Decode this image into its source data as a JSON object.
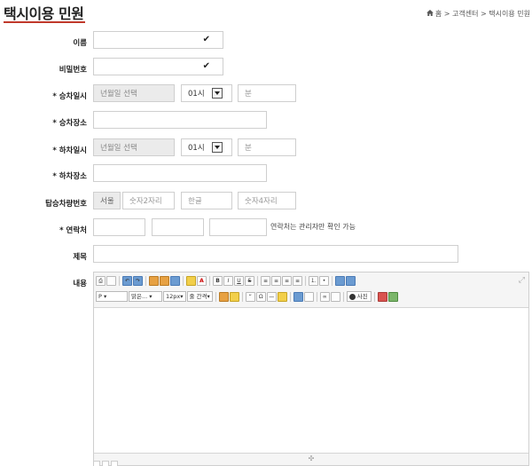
{
  "page": {
    "title": "택시이용 민원",
    "breadcrumb": "홈 > 고객센터 > 택시이용 민원"
  },
  "form": {
    "name": {
      "label": "이름",
      "value": ""
    },
    "password": {
      "label": "비밀번호",
      "value": ""
    },
    "pickup_datetime": {
      "label": "* 승차일시",
      "date_placeholder": "년월일 선택",
      "hour": "01시",
      "minute_placeholder": "분"
    },
    "pickup_place": {
      "label": "* 승차장소",
      "value": ""
    },
    "dropoff_datetime": {
      "label": "* 하차일시",
      "date_placeholder": "년월일 선택",
      "hour": "01시",
      "minute_placeholder": "분"
    },
    "dropoff_place": {
      "label": "* 하차장소",
      "value": ""
    },
    "vehicle_number": {
      "label": "탑승차량번호",
      "region": "서울",
      "p1": "숫자2자리",
      "p2": "한글",
      "p3": "숫자4자리"
    },
    "contact": {
      "label": "* 연락처",
      "note": "연락처는 관리자만 확인 가능"
    },
    "subject": {
      "label": "제목",
      "value": ""
    },
    "content": {
      "label": "내용"
    }
  },
  "editor": {
    "toolbar": {
      "format": "P",
      "font": "맑은...",
      "size": "12px",
      "line_spacing": "줄 간격",
      "photo": "사진",
      "bold": "B",
      "italic": "I",
      "underline": "U",
      "strike": "S",
      "quote": "“",
      "omega": "Ω"
    }
  }
}
